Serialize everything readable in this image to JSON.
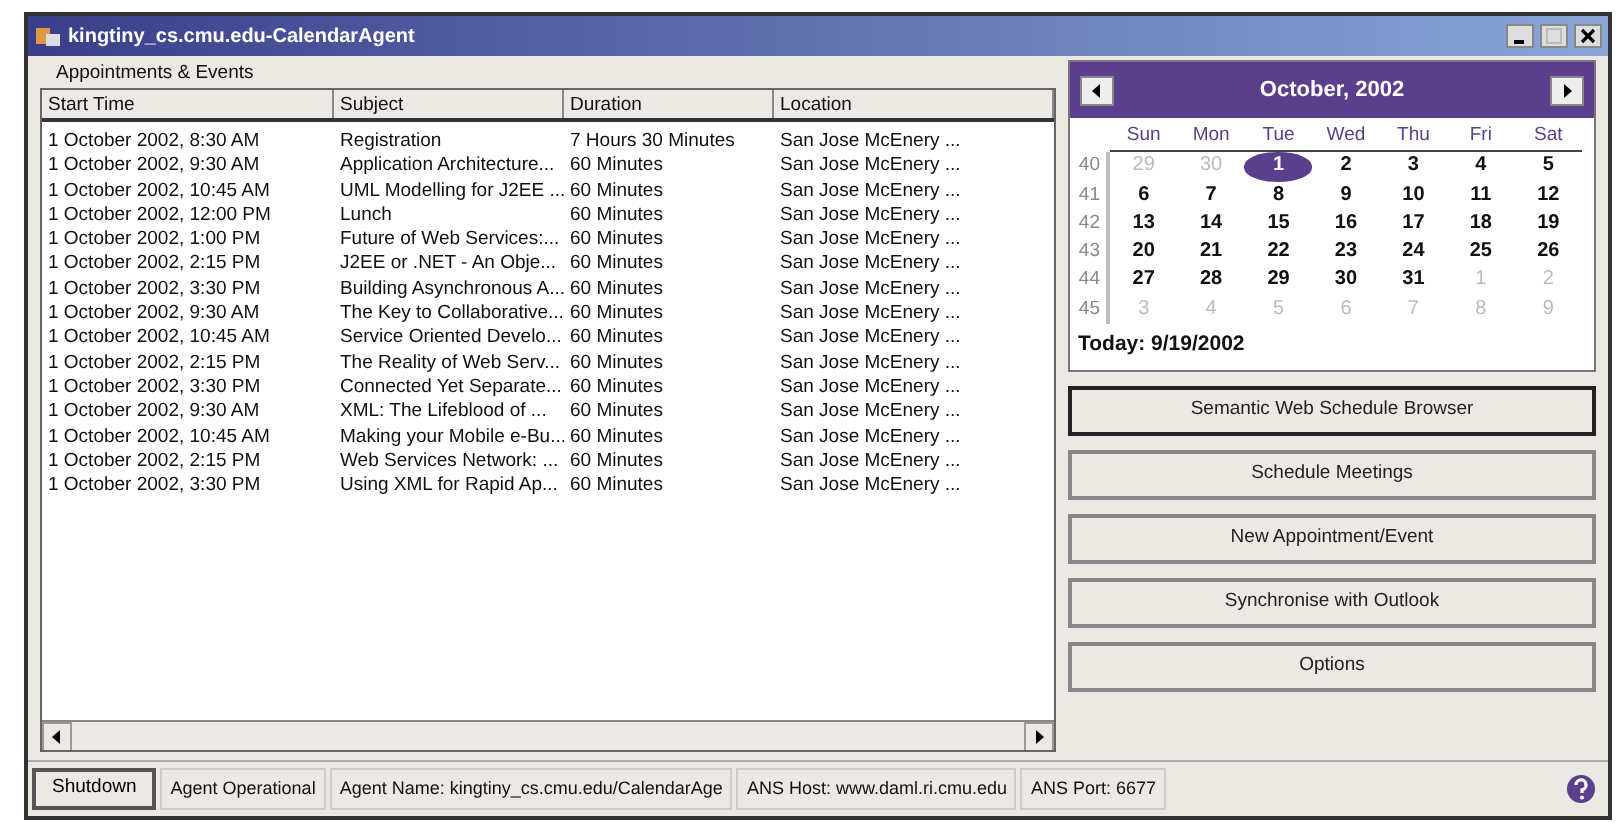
{
  "window": {
    "title": "kingtiny_cs.cmu.edu-CalendarAgent"
  },
  "group_label": "Appointments & Events",
  "table": {
    "columns": [
      "Start Time",
      "Subject",
      "Duration",
      "Location"
    ],
    "rows": [
      [
        "1 October 2002, 8:30 AM",
        "Registration",
        "7 Hours 30 Minutes",
        "San Jose McEnery ..."
      ],
      [
        "1 October 2002, 9:30 AM",
        "Application Architecture...",
        "60 Minutes",
        "San Jose McEnery ..."
      ],
      [
        "1 October 2002, 10:45 AM",
        "UML Modelling for J2EE ...",
        "60 Minutes",
        "San Jose McEnery ..."
      ],
      [
        "1 October 2002, 12:00 PM",
        "Lunch",
        "60 Minutes",
        "San Jose McEnery ..."
      ],
      [
        "1 October 2002, 1:00 PM",
        "Future of Web Services:...",
        "60 Minutes",
        "San Jose McEnery ..."
      ],
      [
        "1 October 2002, 2:15 PM",
        "J2EE or .NET - An Obje...",
        "60 Minutes",
        "San Jose McEnery ..."
      ],
      [
        "1 October 2002, 3:30 PM",
        "Building Asynchronous A...",
        "60 Minutes",
        "San Jose McEnery ..."
      ],
      [
        "1 October 2002, 9:30 AM",
        "The Key to Collaborative...",
        "60 Minutes",
        "San Jose McEnery ..."
      ],
      [
        "1 October 2002, 10:45 AM",
        "Service Oriented Develo...",
        "60 Minutes",
        "San Jose McEnery ..."
      ],
      [
        "1 October 2002, 2:15 PM",
        "The Reality of Web Serv...",
        "60 Minutes",
        "San Jose McEnery ..."
      ],
      [
        "1 October 2002, 3:30 PM",
        "Connected Yet Separate...",
        "60 Minutes",
        "San Jose McEnery ..."
      ],
      [
        "1 October 2002, 9:30 AM",
        "XML: The Lifeblood of ...",
        "60 Minutes",
        "San Jose McEnery ..."
      ],
      [
        "1 October 2002, 10:45 AM",
        "Making your Mobile e-Bu...",
        "60 Minutes",
        "San Jose McEnery ..."
      ],
      [
        "1 October 2002, 2:15 PM",
        "Web Services Network: ...",
        "60 Minutes",
        "San Jose McEnery ..."
      ],
      [
        "1 October 2002, 3:30 PM",
        "Using XML for Rapid Ap...",
        "60 Minutes",
        "San Jose McEnery ..."
      ]
    ]
  },
  "calendar": {
    "month": "October, 2002",
    "weekdays": [
      "Sun",
      "Mon",
      "Tue",
      "Wed",
      "Thu",
      "Fri",
      "Sat"
    ],
    "weeks": [
      {
        "number": "40",
        "days": [
          {
            "text": "29",
            "muted": true,
            "selected": false
          },
          {
            "text": "30",
            "muted": true,
            "selected": false
          },
          {
            "text": "1",
            "muted": false,
            "selected": true
          },
          {
            "text": "2",
            "muted": false,
            "selected": false
          },
          {
            "text": "3",
            "muted": false,
            "selected": false
          },
          {
            "text": "4",
            "muted": false,
            "selected": false
          },
          {
            "text": "5",
            "muted": false,
            "selected": false
          }
        ]
      },
      {
        "number": "41",
        "days": [
          {
            "text": "6",
            "muted": false,
            "selected": false
          },
          {
            "text": "7",
            "muted": false,
            "selected": false
          },
          {
            "text": "8",
            "muted": false,
            "selected": false
          },
          {
            "text": "9",
            "muted": false,
            "selected": false
          },
          {
            "text": "10",
            "muted": false,
            "selected": false
          },
          {
            "text": "11",
            "muted": false,
            "selected": false
          },
          {
            "text": "12",
            "muted": false,
            "selected": false
          }
        ]
      },
      {
        "number": "42",
        "days": [
          {
            "text": "13",
            "muted": false,
            "selected": false
          },
          {
            "text": "14",
            "muted": false,
            "selected": false
          },
          {
            "text": "15",
            "muted": false,
            "selected": false
          },
          {
            "text": "16",
            "muted": false,
            "selected": false
          },
          {
            "text": "17",
            "muted": false,
            "selected": false
          },
          {
            "text": "18",
            "muted": false,
            "selected": false
          },
          {
            "text": "19",
            "muted": false,
            "selected": false
          }
        ]
      },
      {
        "number": "43",
        "days": [
          {
            "text": "20",
            "muted": false,
            "selected": false
          },
          {
            "text": "21",
            "muted": false,
            "selected": false
          },
          {
            "text": "22",
            "muted": false,
            "selected": false
          },
          {
            "text": "23",
            "muted": false,
            "selected": false
          },
          {
            "text": "24",
            "muted": false,
            "selected": false
          },
          {
            "text": "25",
            "muted": false,
            "selected": false
          },
          {
            "text": "26",
            "muted": false,
            "selected": false
          }
        ]
      },
      {
        "number": "44",
        "days": [
          {
            "text": "27",
            "muted": false,
            "selected": false
          },
          {
            "text": "28",
            "muted": false,
            "selected": false
          },
          {
            "text": "29",
            "muted": false,
            "selected": false
          },
          {
            "text": "30",
            "muted": false,
            "selected": false
          },
          {
            "text": "31",
            "muted": false,
            "selected": false
          },
          {
            "text": "1",
            "muted": true,
            "selected": false
          },
          {
            "text": "2",
            "muted": true,
            "selected": false
          }
        ]
      },
      {
        "number": "45",
        "days": [
          {
            "text": "3",
            "muted": true,
            "selected": false
          },
          {
            "text": "4",
            "muted": true,
            "selected": false
          },
          {
            "text": "5",
            "muted": true,
            "selected": false
          },
          {
            "text": "6",
            "muted": true,
            "selected": false
          },
          {
            "text": "7",
            "muted": true,
            "selected": false
          },
          {
            "text": "8",
            "muted": true,
            "selected": false
          },
          {
            "text": "9",
            "muted": true,
            "selected": false
          }
        ]
      }
    ],
    "today": "Today: 9/19/2002"
  },
  "buttons": [
    {
      "label": "Semantic Web Schedule Browser",
      "focused": true
    },
    {
      "label": "Schedule Meetings",
      "focused": false
    },
    {
      "label": "New Appointment/Event",
      "focused": false
    },
    {
      "label": "Synchronise with Outlook",
      "focused": false
    },
    {
      "label": "Options",
      "focused": false
    }
  ],
  "status_bar": {
    "button": "Shutdown",
    "fields": [
      "Agent Operational",
      "Agent Name: kingtiny_cs.cmu.edu/CalendarAge",
      "ANS Host: www.daml.ri.cmu.edu",
      "ANS Port: 6677"
    ]
  }
}
